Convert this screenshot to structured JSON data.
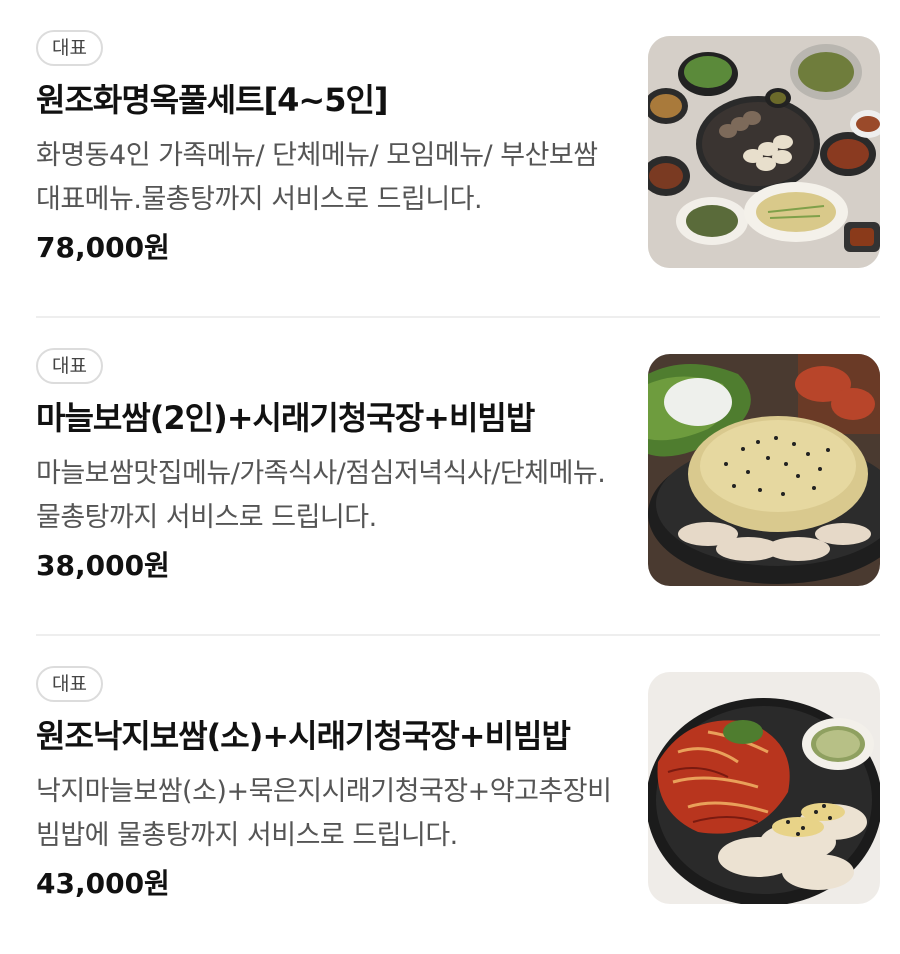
{
  "menu": {
    "items": [
      {
        "badge": "대표",
        "name": "원조화명옥풀세트[4~5인]",
        "description": "화명동4인 가족메뉴/ 단체메뉴/ 모임메뉴/ 부산보쌈대표메뉴.물총탕까지 서비스로 드립니다.",
        "price": "78,000원",
        "image": "food-photo-full-set"
      },
      {
        "badge": "대표",
        "name": "마늘보쌈(2인)+시래기청국장+비빔밥",
        "description": "마늘보쌈맛집메뉴/가족식사/점심저녁식사/단체메뉴.물총탕까지 서비스로 드립니다.",
        "price": "38,000원",
        "image": "food-photo-garlic-bossam"
      },
      {
        "badge": "대표",
        "name": "원조낙지보쌈(소)+시래기청국장+비빔밥",
        "description": "낙지마늘보쌈(소)+묵은지시래기청국장+약고추장비빔밥에 물총탕까지 서비스로 드립니다.",
        "price": "43,000원",
        "image": "food-photo-octopus-bossam"
      }
    ]
  }
}
